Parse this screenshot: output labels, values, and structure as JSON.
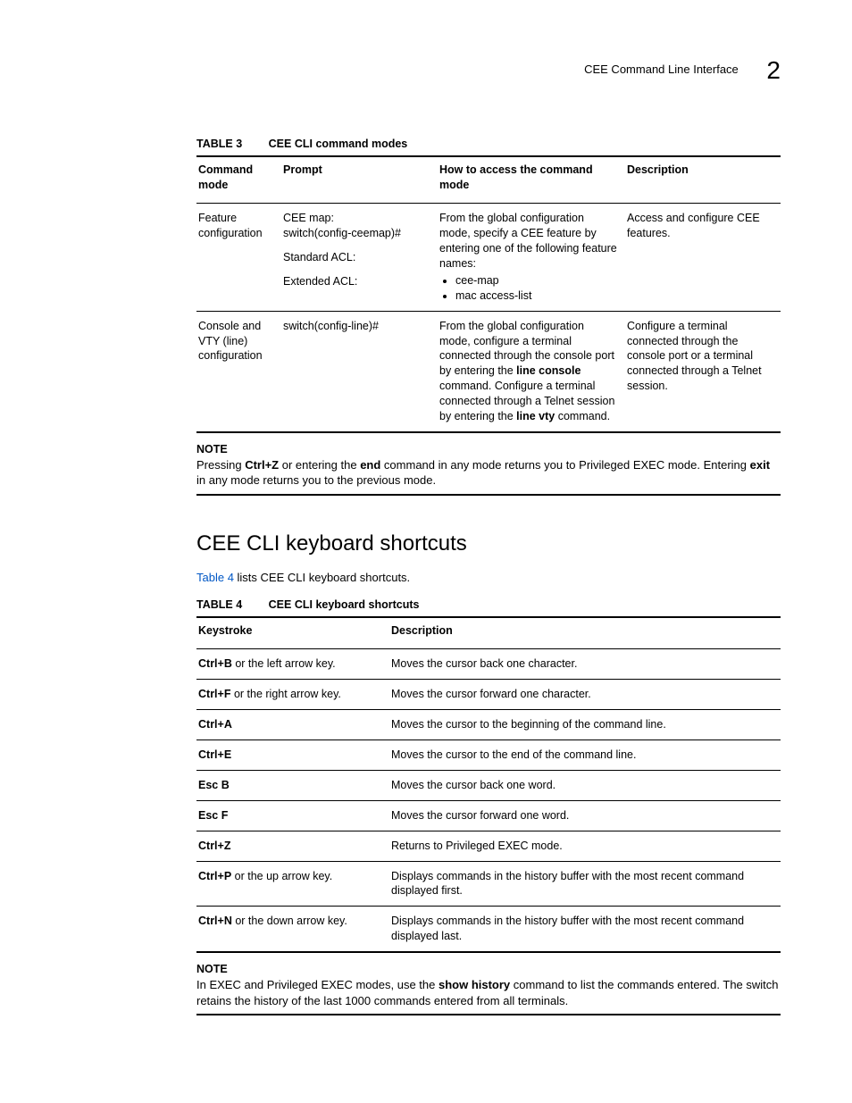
{
  "header": {
    "running_title": "CEE Command Line Interface",
    "chapter_number": "2"
  },
  "table3": {
    "label": "TABLE 3",
    "title": "CEE CLI command modes",
    "headers": [
      "Command mode",
      "Prompt",
      "How to access the command mode",
      "Description"
    ],
    "rows": [
      {
        "mode": "Feature configuration",
        "prompt_lines": [
          {
            "label": "CEE map:",
            "value": "switch(config-ceemap)#"
          },
          {
            "label": "Standard ACL:",
            "value": ""
          },
          {
            "label": "Extended ACL:",
            "value": ""
          }
        ],
        "access_intro": "From the global configuration mode, specify a CEE feature by entering one of the following feature names:",
        "features": [
          "cee-map",
          "mac access-list"
        ],
        "description": "Access and configure CEE features."
      },
      {
        "mode": "Console and VTY (line) configuration",
        "prompt_plain": "switch(config-line)#",
        "access_parts": {
          "p1": "From the global configuration mode, configure a terminal connected through the console port by entering the ",
          "b1": "line console",
          "p2": " command. Configure a terminal connected through a Telnet session by entering the ",
          "b2": "line vty",
          "p3": " command."
        },
        "description": "Configure a terminal connected through the console port or a terminal connected through a Telnet session."
      }
    ]
  },
  "note1": {
    "heading": "NOTE",
    "parts": {
      "p1": "Pressing ",
      "b1": "Ctrl+Z",
      "p2": " or entering the ",
      "b2": "end",
      "p3": " command in any mode returns you to Privileged EXEC mode. Entering ",
      "b3": "exit",
      "p4": " in any mode returns you to the previous mode."
    }
  },
  "section2": {
    "heading": "CEE CLI keyboard shortcuts",
    "intro_link": "Table 4",
    "intro_rest": " lists CEE CLI keyboard shortcuts."
  },
  "table4": {
    "label": "TABLE 4",
    "title": "CEE CLI keyboard shortcuts",
    "headers": [
      "Keystroke",
      "Description"
    ],
    "rows": [
      {
        "kb": "Ctrl+B",
        "ksuffix": " or the left arrow key.",
        "desc": "Moves the cursor back one character."
      },
      {
        "kb": "Ctrl+F",
        "ksuffix": " or the right arrow key.",
        "desc": "Moves the cursor forward one character."
      },
      {
        "kb": "Ctrl+A",
        "ksuffix": "",
        "desc": "Moves the cursor to the beginning of the command line."
      },
      {
        "kb": "Ctrl+E",
        "ksuffix": "",
        "desc": "Moves the cursor to the end of the command line."
      },
      {
        "kb": "Esc B",
        "ksuffix": "",
        "desc": "Moves the cursor back one word."
      },
      {
        "kb": "Esc F",
        "ksuffix": "",
        "desc": "Moves the cursor forward one word."
      },
      {
        "kb": "Ctrl+Z",
        "ksuffix": "",
        "desc": "Returns to Privileged EXEC mode."
      },
      {
        "kb": "Ctrl+P",
        "ksuffix": " or the up arrow key.",
        "desc": "Displays commands in the history buffer with the most recent command displayed first."
      },
      {
        "kb": "Ctrl+N",
        "ksuffix": " or the down arrow key.",
        "desc": "Displays commands in the history buffer with the most recent command displayed last."
      }
    ]
  },
  "note2": {
    "heading": "NOTE",
    "parts": {
      "p1": "In EXEC and Privileged EXEC modes, use the ",
      "b1": "show history",
      "p2": " command to list the commands entered. The switch retains the history of the last 1000 commands entered from all terminals."
    }
  }
}
